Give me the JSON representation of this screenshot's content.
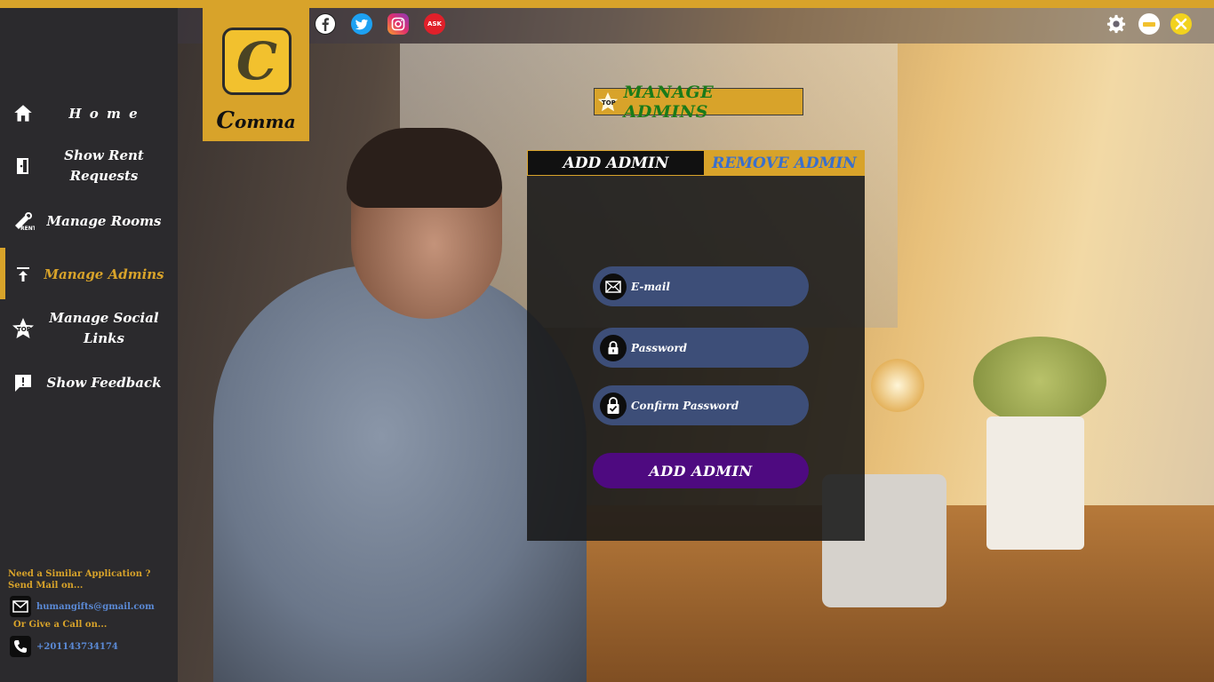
{
  "app": {
    "logo_letter": "C",
    "logo_text": "omma",
    "logo_text_initial": "C"
  },
  "sidebar": {
    "items": [
      {
        "label": "H o m e",
        "icon": "home-icon"
      },
      {
        "label": "Show Rent Requests",
        "icon": "door-icon"
      },
      {
        "label": "Manage Rooms",
        "icon": "rent-key-icon"
      },
      {
        "label": "Manage Admins",
        "icon": "upload-arrow-icon",
        "active": true
      },
      {
        "label": "Manage Social Links",
        "icon": "top-star-icon"
      },
      {
        "label": "Show Feedback",
        "icon": "feedback-icon"
      }
    ],
    "contact": {
      "line1": "Need a Similar Application ?",
      "line2": "Send Mail on...",
      "email": "humangifts@gmail.com",
      "call_label": "Or Give a Call on...",
      "phone": "+201143734174"
    }
  },
  "social": [
    {
      "name": "facebook-icon",
      "color": "#ffffff"
    },
    {
      "name": "twitter-icon",
      "color": "#1da1f2"
    },
    {
      "name": "instagram-icon",
      "color": "#e1306c"
    },
    {
      "name": "ask-icon",
      "color": "#e0202a",
      "text": "ASK"
    }
  ],
  "window_controls": {
    "settings": "gear-icon",
    "minimize": "minimize-icon",
    "close": "close-icon"
  },
  "page_title": {
    "text": "MANAGE ADMINS",
    "badge": "TOP"
  },
  "tabs": {
    "add": "ADD ADMIN",
    "remove": "REMOVE ADMIN"
  },
  "form": {
    "email_placeholder": "E-mail",
    "password_placeholder": "Password",
    "confirm_placeholder": "Confirm Password",
    "submit_label": "ADD ADMIN"
  },
  "colors": {
    "accent": "#d8a32a",
    "sidebar": "#2b2a2d",
    "field": "#3d4e78",
    "submit": "#4e0a80",
    "title_text": "#1a7a1a",
    "remove_tab_text": "#3a6fcc"
  }
}
